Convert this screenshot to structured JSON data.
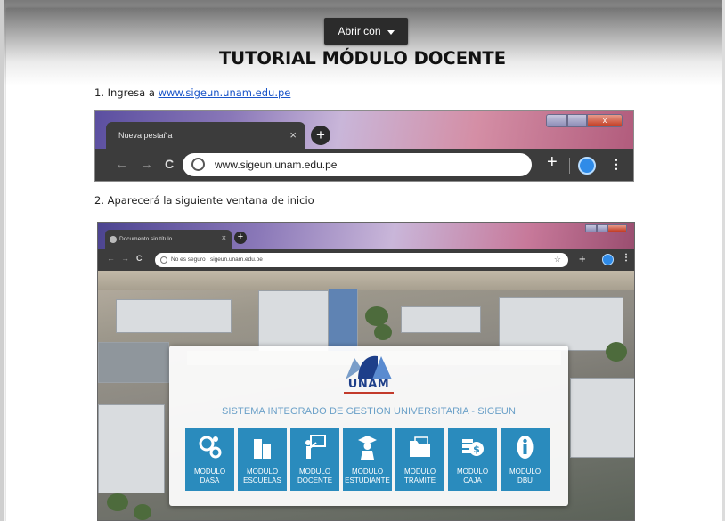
{
  "viewer": {
    "open_with_label": "Abrir con"
  },
  "document": {
    "title": "TUTORIAL MÓDULO DOCENTE",
    "step1_text": "1.  Ingresa a ",
    "step1_link": "www.sigeun.unam.edu.pe",
    "step2_text": "2.  Aparecerá la siguiente ventana de inicio"
  },
  "browser1": {
    "tab_title": "Nueva pestaña",
    "tab_close": "×",
    "new_tab": "+",
    "url": "www.sigeun.unam.edu.pe",
    "back": "←",
    "forward": "→",
    "reload": "C",
    "toolbar_plus": "+",
    "menu": "⋮",
    "win_close": "x"
  },
  "browser2": {
    "tab_title": "Documento sin título",
    "tab_close": "×",
    "new_tab": "+",
    "url_warning": "No es seguro",
    "url": "sigeun.unam.edu.pe",
    "back": "←",
    "forward": "→",
    "reload": "C",
    "star": "☆",
    "toolbar_plus": "+",
    "menu": "⋮"
  },
  "sigeun": {
    "logo_text": "UNAM",
    "system_title": "SISTEMA INTEGRADO DE GESTION UNIVERSITARIA - SIGEUN",
    "modules": [
      {
        "line1": "MODULO",
        "line2": "DASA",
        "icon": "gears-icon"
      },
      {
        "line1": "MODULO",
        "line2": "ESCUELAS",
        "icon": "building-icon"
      },
      {
        "line1": "MODULO",
        "line2": "DOCENTE",
        "icon": "teacher-board-icon"
      },
      {
        "line1": "MODULO",
        "line2": "ESTUDIANTE",
        "icon": "graduate-icon"
      },
      {
        "line1": "MODULO",
        "line2": "TRAMITE",
        "icon": "folder-icon"
      },
      {
        "line1": "MODULO",
        "line2": "CAJA",
        "icon": "coins-icon"
      },
      {
        "line1": "MODULO",
        "line2": "DBU",
        "icon": "info-person-icon"
      }
    ]
  },
  "colors": {
    "module_blue": "#2a8bbd",
    "link_blue": "#1a55c8",
    "unam_navy": "#1e3f8a",
    "system_title_blue": "#6aa0c8"
  }
}
